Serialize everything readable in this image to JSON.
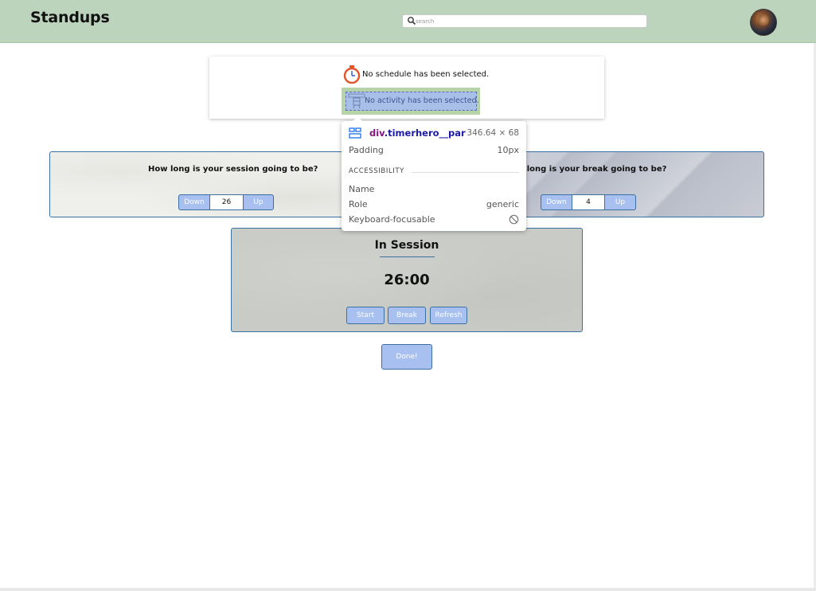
{
  "header": {
    "title": "Standups",
    "search": {
      "placeholder": "search",
      "value": ""
    },
    "accent_color": "#bcd4bc"
  },
  "timer_hero": {
    "schedule_text": "No schedule has been selected.",
    "activity_text": "No activity has been selected."
  },
  "session_settings": {
    "question": "How long is your session going to be?",
    "down_label": "Down",
    "value": "26",
    "up_label": "Up"
  },
  "break_settings": {
    "question": "How long is your break going to be?",
    "visible_question": "w long is your break going to be?",
    "down_label": "Down",
    "value": "4",
    "up_label": "Up"
  },
  "session": {
    "title": "In Session",
    "time": "26:00",
    "buttons": {
      "start": "Start",
      "break": "Break",
      "refresh": "Refresh"
    }
  },
  "done_label": "Done!",
  "devtools_tooltip": {
    "selector_tag": "div",
    "selector_class": ".timerhero__par",
    "size": "346.64 × 68",
    "padding_label": "Padding",
    "padding_value": "10px",
    "section": "ACCESSIBILITY",
    "name_label": "Name",
    "name_value": "",
    "role_label": "Role",
    "role_value": "generic",
    "focus_label": "Keyboard-focusable",
    "focus_icon": "no-entry-icon"
  },
  "colors": {
    "button_fill": "#a8c0f0",
    "button_border": "#3a6fa0",
    "activity_highlight": "#b7d3a8",
    "devtools_tag": "#881280",
    "devtools_class": "#1a1aa6"
  }
}
